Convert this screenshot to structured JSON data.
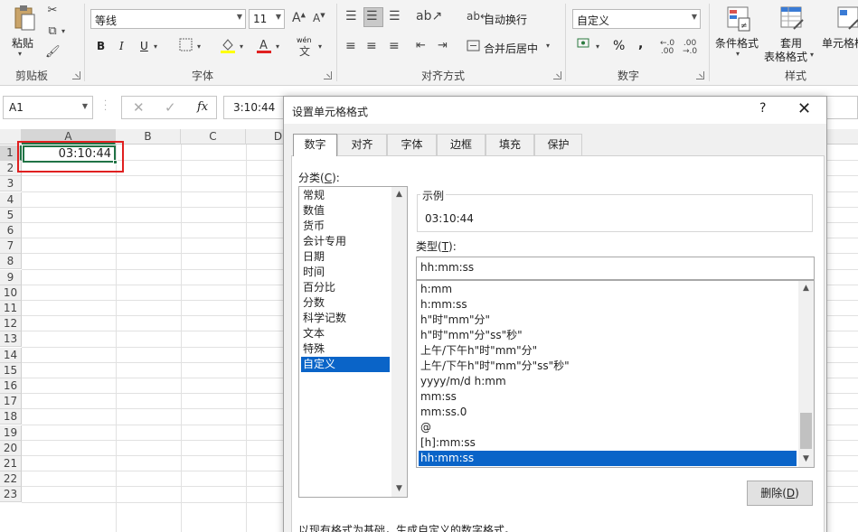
{
  "ribbon": {
    "clipboard": {
      "paste_label": "粘贴",
      "group_label": "剪贴板"
    },
    "font": {
      "font_name": "等线",
      "font_size": "11",
      "bold": "B",
      "italic": "I",
      "underline": "U",
      "phonetic_label": "wén",
      "group_label": "字体"
    },
    "alignment": {
      "wrap_text": "自动换行",
      "merge_center": "合并后居中",
      "group_label": "对齐方式"
    },
    "number": {
      "format_value": "自定义",
      "percent": "%",
      "comma": ",",
      "group_label": "数字"
    },
    "styles": {
      "conditional_format": "条件格式",
      "table_format_line1": "套用",
      "table_format_line2": "表格格式",
      "cell_styles": "单元格样",
      "group_label": "样式"
    }
  },
  "formula_bar": {
    "name_box": "A1",
    "fx": "fx",
    "content": "3:10:44"
  },
  "sheet": {
    "columns": [
      "A",
      "B",
      "C",
      "D"
    ],
    "rows": [
      "1",
      "2",
      "3",
      "4",
      "5",
      "6",
      "7",
      "8",
      "9",
      "10",
      "11",
      "12",
      "13",
      "14",
      "15",
      "16",
      "17",
      "18",
      "19",
      "20",
      "21",
      "22",
      "23"
    ],
    "cell_a1": "03:10:44"
  },
  "dialog": {
    "title": "设置单元格格式",
    "help": "?",
    "close": "✕",
    "tabs": [
      "数字",
      "对齐",
      "字体",
      "边框",
      "填充",
      "保护"
    ],
    "active_tab": "数字",
    "category_label": "分类(",
    "category_key": "C",
    "category_label_end": "):",
    "categories": [
      "常规",
      "数值",
      "货币",
      "会计专用",
      "日期",
      "时间",
      "百分比",
      "分数",
      "科学记数",
      "文本",
      "特殊",
      "自定义"
    ],
    "selected_category": "自定义",
    "sample_label": "示例",
    "sample_value": "03:10:44",
    "type_label": "类型(",
    "type_key": "T",
    "type_label_end": "):",
    "type_value": "hh:mm:ss",
    "formats": [
      "h:mm",
      "h:mm:ss",
      "h\"时\"mm\"分\"",
      "h\"时\"mm\"分\"ss\"秒\"",
      "上午/下午h\"时\"mm\"分\"",
      "上午/下午h\"时\"mm\"分\"ss\"秒\"",
      "yyyy/m/d h:mm",
      "mm:ss",
      "mm:ss.0",
      "@",
      "[h]:mm:ss",
      "hh:mm:ss"
    ],
    "selected_format": "hh:mm:ss",
    "delete_label": "删除(",
    "delete_key": "D",
    "delete_label_end": ")",
    "footer_text": "以现有格式为基础，生成自定义的数字格式。"
  },
  "colors": {
    "excel_green": "#217346",
    "selection_blue": "#0a64c8",
    "highlight_red": "#e02020",
    "font_color_red": "#e02020",
    "fill_yellow": "#ffff00"
  }
}
